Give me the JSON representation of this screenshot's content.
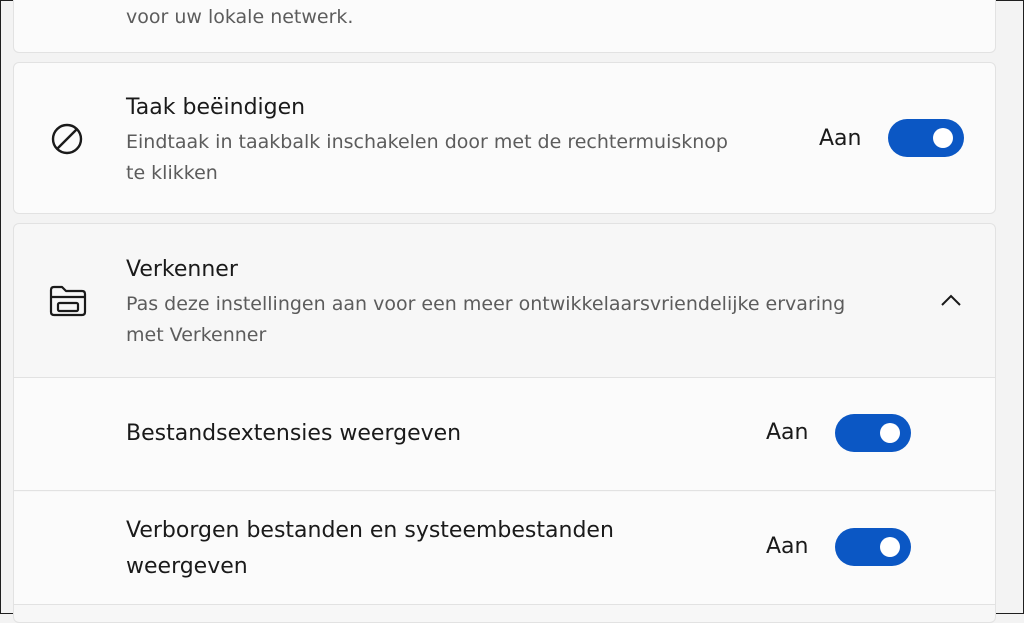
{
  "top_card": {
    "description_tail": "voor uw lokale netwerk."
  },
  "task_end": {
    "icon": "prohibited-icon",
    "title": "Taak beëindigen",
    "description_line1": "Eindtaak in taakbalk inschakelen door met de rechtermuisknop",
    "description_line2": "te klikken",
    "state": "Aan",
    "toggle_on": true
  },
  "explorer": {
    "icon": "folder-icon",
    "title": "Verkenner",
    "description_line1": "Pas deze instellingen aan voor een meer ontwikkelaarsvriendelijke ervaring",
    "description_line2": "met Verkenner",
    "expanded": true,
    "items": [
      {
        "label_line1": "Bestandsextensies weergeven",
        "label_line2": "",
        "state": "Aan",
        "toggle_on": true
      },
      {
        "label_line1": "Verborgen bestanden en systeembestanden",
        "label_line2": "weergeven",
        "state": "Aan",
        "toggle_on": true
      }
    ]
  },
  "colors": {
    "accent": "#0b57c4",
    "background": "#f3f3f3",
    "card": "#fbfbfb"
  }
}
